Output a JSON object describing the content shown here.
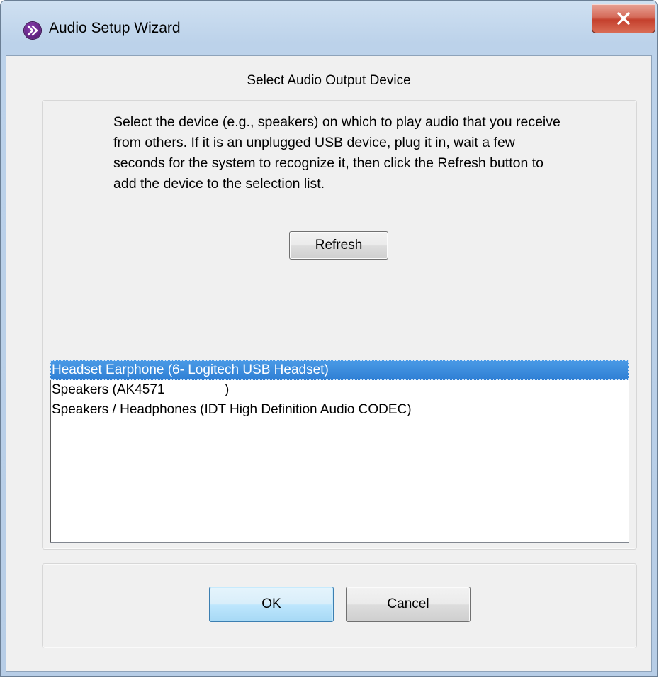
{
  "window": {
    "title": "Audio Setup Wizard",
    "app_icon": "purple-chevron-icon",
    "close_icon": "close-x-icon",
    "close_color": "#c4402d"
  },
  "dialog": {
    "heading": "Select Audio Output Device",
    "instructions": "Select the device (e.g., speakers) on which to play audio that you receive from others. If it is an unplugged USB device, plug it in, wait a few seconds for the system to recognize it, then click the Refresh button to add the device to the selection list.",
    "refresh_label": "Refresh",
    "devices": [
      {
        "label": "Headset Earphone (6- Logitech USB Headset)",
        "selected": true
      },
      {
        "label": "Speakers (AK4571                )",
        "selected": false
      },
      {
        "label": "Speakers / Headphones (IDT High Definition Audio CODEC)",
        "selected": false
      }
    ],
    "ok_label": "OK",
    "cancel_label": "Cancel",
    "selection_color": "#3a8ad9"
  }
}
